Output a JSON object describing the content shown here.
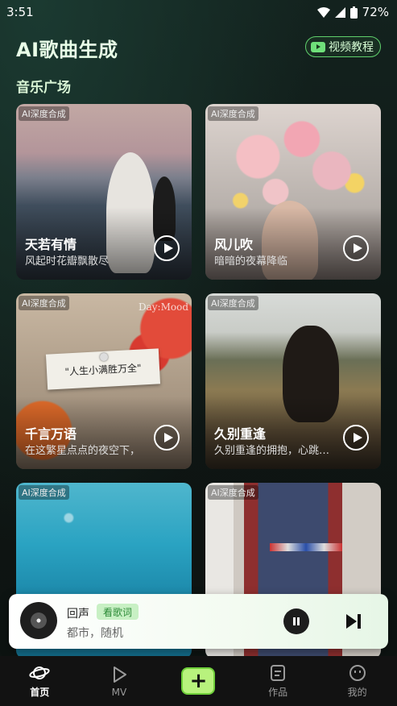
{
  "status_bar": {
    "time": "3:51",
    "battery": "72%"
  },
  "header": {
    "title": "AI歌曲生成",
    "tutorial_label": "视频教程"
  },
  "section": {
    "title": "音乐广场"
  },
  "cards": [
    {
      "tag": "AI深度合成",
      "title": "天若有情",
      "subtitle": "风起时花瓣飘散尽"
    },
    {
      "tag": "AI深度合成",
      "title": "风儿吹",
      "subtitle": "暗暗的夜幕降临"
    },
    {
      "tag": "AI深度合成",
      "title": "千言万语",
      "subtitle": "在这繁星点点的夜空下，",
      "paper_text": "\"人生小满胜万全\"",
      "watermark": "Day:Mood"
    },
    {
      "tag": "AI深度合成",
      "title": "久别重逢",
      "subtitle": "久别重逢的拥抱，心跳…"
    },
    {
      "tag": "AI深度合成"
    },
    {
      "tag": "AI深度合成"
    }
  ],
  "player": {
    "title": "回声",
    "lyrics_label": "看歌词",
    "artist": "都市，随机"
  },
  "nav": [
    {
      "label": "首页",
      "icon": "planet-icon",
      "active": true
    },
    {
      "label": "MV",
      "icon": "play-outline-icon",
      "active": false
    },
    {
      "label": "",
      "icon": "plus-icon",
      "active": false
    },
    {
      "label": "作品",
      "icon": "document-icon",
      "active": false
    },
    {
      "label": "我的",
      "icon": "face-icon",
      "active": false
    }
  ],
  "colors": {
    "accent": "#6fcf3a",
    "background": "#0f1a17"
  }
}
